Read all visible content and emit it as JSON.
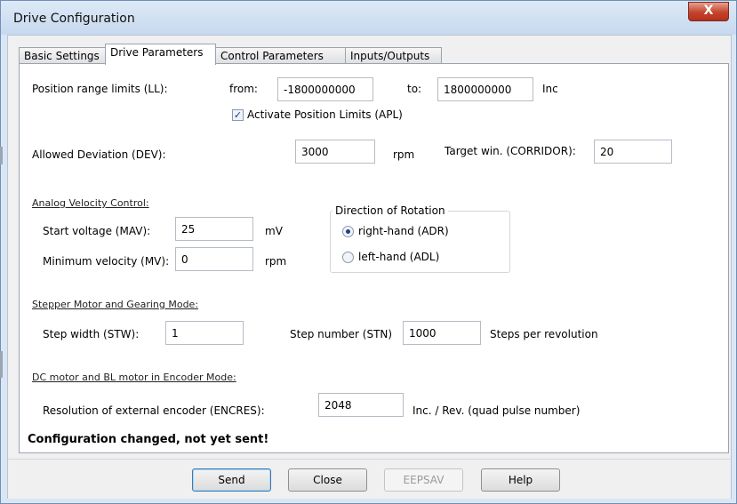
{
  "window": {
    "title": "Drive Configuration",
    "close_glyph": "X"
  },
  "tabs": [
    {
      "label": "Basic Settings",
      "active": false
    },
    {
      "label": "Drive Parameters",
      "active": true
    },
    {
      "label": "Control Parameters",
      "active": false
    },
    {
      "label": "Inputs/Outputs",
      "active": false
    }
  ],
  "position_range": {
    "label": "Position range limits (LL):",
    "from_label": "from:",
    "from_value": "-1800000000",
    "to_label": "to:",
    "to_value": "1800000000",
    "unit": "Inc",
    "checkbox_label": "Activate Position Limits (APL)",
    "checkbox_checked": true
  },
  "deviation": {
    "label": "Allowed Deviation (DEV):",
    "value": "3000",
    "unit": "rpm",
    "corridor_label": "Target win. (CORRIDOR):",
    "corridor_value": "20"
  },
  "analog": {
    "section_title": "Analog Velocity Control:",
    "start_voltage_label": "Start voltage (MAV):",
    "start_voltage_value": "25",
    "start_voltage_unit": "mV",
    "min_velocity_label": "Minimum velocity (MV):",
    "min_velocity_value": "0",
    "min_velocity_unit": "rpm"
  },
  "rotation": {
    "group_title": "Direction of Rotation",
    "options": [
      {
        "label": "right-hand (ADR)",
        "selected": true
      },
      {
        "label": "left-hand (ADL)",
        "selected": false
      }
    ]
  },
  "stepper": {
    "section_title": "Stepper Motor and Gearing Mode:",
    "step_width_label": "Step width (STW):",
    "step_width_value": "1",
    "step_number_label": "Step number (STN)",
    "step_number_value": "1000",
    "step_number_unit": "Steps per revolution"
  },
  "encoder": {
    "section_title": "DC motor and BL motor in Encoder Mode:",
    "resolution_label": "Resolution of external encoder (ENCRES):",
    "resolution_value": "2048",
    "resolution_unit": "Inc. / Rev. (quad pulse number)"
  },
  "status_message": "Configuration changed, not yet sent!",
  "buttons": {
    "send": "Send",
    "close": "Close",
    "eepsav": "EEPSAV",
    "help": "Help"
  },
  "colors": {
    "title_bar": "#c7d9ef",
    "close_button": "#c4432d",
    "panel_background": "#ffffff",
    "dialog_background": "#f0f0f0",
    "default_button_border": "#3d7bad"
  }
}
